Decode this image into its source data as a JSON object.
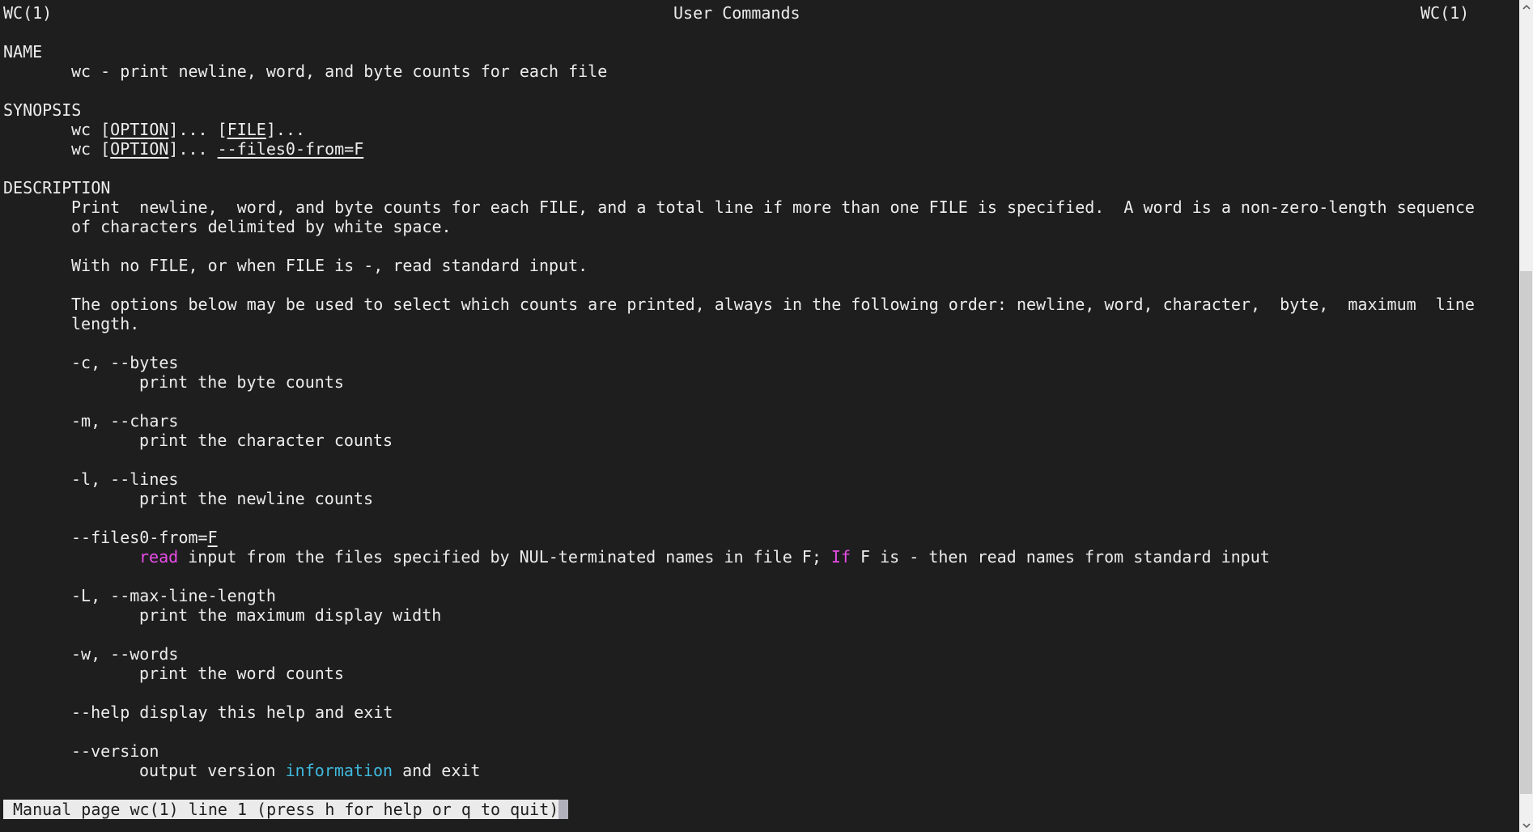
{
  "header": {
    "left": "WC(1)",
    "center": "User Commands",
    "right": "WC(1)"
  },
  "sections": {
    "name": {
      "heading": "NAME",
      "text": "wc - print newline, word, and byte counts for each file"
    },
    "synopsis": {
      "heading": "SYNOPSIS",
      "lines": [
        {
          "cmd": "wc ",
          "open1": "[",
          "arg1": "OPTION",
          "close1": "]... ",
          "open2": "[",
          "arg2": "FILE",
          "close2": "]..."
        },
        {
          "cmd": "wc ",
          "open1": "[",
          "arg1": "OPTION",
          "close1": "]... ",
          "arg2": "--files0-from=F"
        }
      ]
    },
    "description": {
      "heading": "DESCRIPTION",
      "para1": [
        "Print  newline,  word, and byte counts for each FILE, and a total line if more than one FILE is specified.  A word is a non-zero-length sequence",
        "of characters delimited by white space."
      ],
      "para2": "With no FILE, or when FILE is -, read standard input.",
      "para3": [
        "The options below may be used to select which counts are printed, always in the following order: newline, word, character,  byte,  maximum  line",
        "length."
      ]
    },
    "options": [
      {
        "flag": "-c, --bytes",
        "desc": "print the byte counts"
      },
      {
        "flag": "-m, --chars",
        "desc": "print the character counts"
      },
      {
        "flag": "-l, --lines",
        "desc": "print the newline counts"
      },
      {
        "flag_prefix": "--files0-from=",
        "flag_arg": "F",
        "desc_hl1": "read",
        "desc_mid": " input from the files specified by NUL-terminated names in file F; ",
        "desc_hl2": "If",
        "desc_end": " F is - then read names from standard input"
      },
      {
        "flag": "-L, --max-line-length",
        "desc": "print the maximum display width"
      },
      {
        "flag": "-w, --words",
        "desc": "print the word counts"
      },
      {
        "flag": "--help display this help and exit"
      },
      {
        "flag": "--version",
        "desc_pre": "output version ",
        "desc_hl": "information",
        "desc_post": " and exit"
      }
    ]
  },
  "status_bar": {
    "text": "Manual page wc(1) line 1 (press h for help or q to quit)"
  },
  "colors": {
    "background": "#1e1e1e",
    "foreground": "#ececec",
    "highlight_magenta": "#e84ce8",
    "highlight_cyan": "#3fb8dc",
    "status_bg": "#ebebeb"
  },
  "scrollbar": {
    "position_fraction": 0.32,
    "visible_fraction": 0.65
  }
}
